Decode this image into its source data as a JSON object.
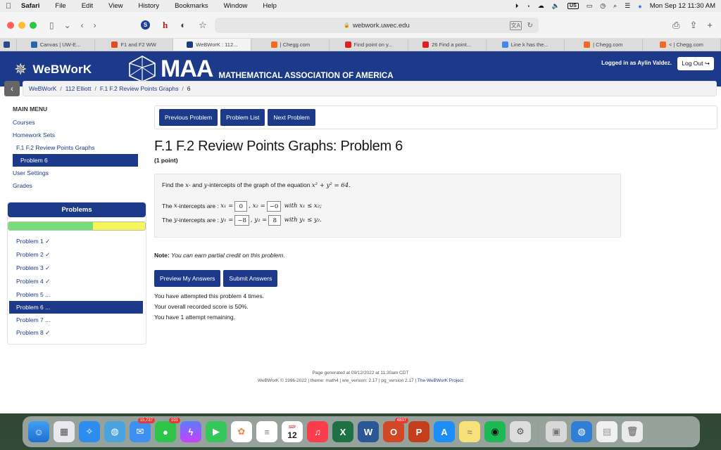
{
  "menubar": {
    "items": [
      "Safari",
      "File",
      "Edit",
      "View",
      "History",
      "Bookmarks",
      "Window",
      "Help"
    ],
    "status_us": "US",
    "datetime": "Mon Sep 12  11:30 AM"
  },
  "browser": {
    "url": "webwork.uwec.edu",
    "tabs": [
      {
        "label": "",
        "color": "#2a4a8a"
      },
      {
        "label": "Canvas | UW-E...",
        "color": "#2a64b0"
      },
      {
        "label": "F1 and F2 WW",
        "color": "#e24b1f"
      },
      {
        "label": "WeBWorK : 112...",
        "color": "#1d3a8a"
      },
      {
        "label": "| Chegg.com",
        "color": "#f26a21"
      },
      {
        "label": "Find point on y...",
        "color": "#e02020"
      },
      {
        "label": "26 Find a point...",
        "color": "#e02020"
      },
      {
        "label": "Line k has the...",
        "color": "#4285f4"
      },
      {
        "label": "| Chegg.com",
        "color": "#f26a21"
      },
      {
        "label": "< | Chegg.com",
        "color": "#f26a21"
      }
    ]
  },
  "header": {
    "logo_text": "WeBWorK",
    "maa_big": "MAA",
    "maa_sub": "MATHEMATICAL ASSOCIATION OF AMERICA",
    "logged_in": "Logged in as Aylin Valdez.",
    "logout": "Log Out"
  },
  "breadcrumb": {
    "items": [
      "WeBWorK",
      "112 Elliott",
      "F.1 F.2 Review Points Graphs"
    ],
    "current": "6",
    "sep": "/"
  },
  "sidebar": {
    "title": "MAIN MENU",
    "courses": "Courses",
    "homework_sets": "Homework Sets",
    "set_name": "F.1 F.2 Review Points Graphs",
    "problem": "Problem 6",
    "user_settings": "User Settings",
    "grades": "Grades",
    "problems_heading": "Problems",
    "progress": {
      "correct_fraction": 0.62,
      "partial_fraction": 0.38
    },
    "problem_list": [
      "Problem 1 ✓",
      "Problem 2 ✓",
      "Problem 3 ✓",
      "Problem 4 ✓",
      "Problem 5 ...",
      "Problem 6 ...",
      "Problem 7 ...",
      "Problem 8 ✓"
    ],
    "active_index": 5
  },
  "main": {
    "buttons": {
      "previous": "Previous Problem",
      "list": "Problem List",
      "next": "Next Problem"
    },
    "title": "F.1 F.2 Review Points Graphs: Problem 6",
    "points": "(1 point)",
    "question_prefix": "Find the",
    "question_x": "x",
    "question_mid": "- and",
    "question_y": "y",
    "question_suffix": "-intercepts of the graph of the equation",
    "equation": "x² + y² = 64.",
    "x_label_pre": "The",
    "x_var": "x",
    "x_label_post": "-intercepts are :",
    "x1_label": "x₁ =",
    "x1_value": "0",
    "x2_label": ", x₂ =",
    "x2_value": "−0",
    "x_cond": "with x₁ ≤ x₂;",
    "y_label_pre": "The",
    "y_var": "y",
    "y_label_post": "-intercepts are :",
    "y1_label": "y₁ =",
    "y1_value": "−8",
    "y2_label": ", y₂ =",
    "y2_value": "8",
    "y_cond": "with y₁ ≤ y₂.",
    "note_label": "Note:",
    "note_text": "You can earn partial credit on this problem.",
    "preview": "Preview My Answers",
    "submit": "Submit Answers",
    "status1": "You have attempted this problem 4 times.",
    "status2": "Your overall recorded score is 50%.",
    "status3": "You have 1 attempt remaining."
  },
  "footer": {
    "line1": "Page generated at 09/12/2022 at 11:30am CDT",
    "line2_prefix": "WeBWorK © 1996-2022 | theme: math4 | ww_version: 2.17 | pg_version 2.17 |",
    "line2_link": "The WeBWorK Project"
  },
  "dock": {
    "mail_badge": "15,737",
    "messages_badge": "101",
    "calendar_month": "SEP",
    "calendar_day": "12",
    "office_badge": "4837"
  }
}
